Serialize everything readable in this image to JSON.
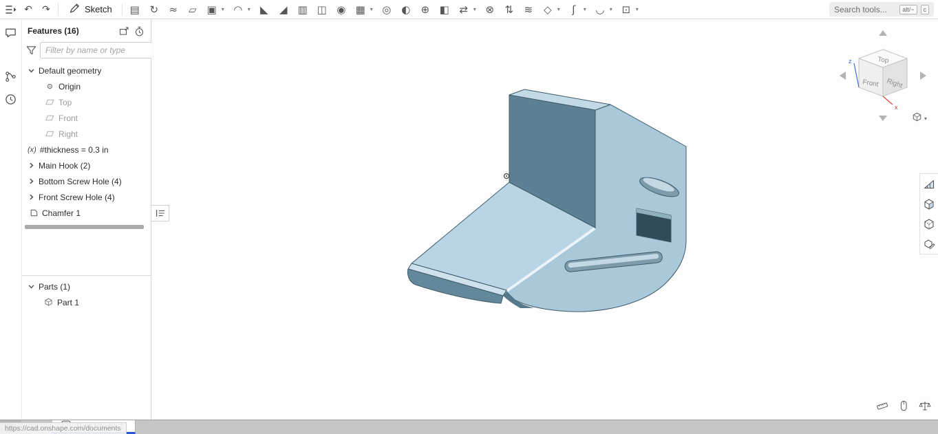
{
  "toolbar": {
    "undo_icon": "↶",
    "redo_icon": "↷",
    "sketch_label": "Sketch",
    "caret_icon": "▾",
    "items": [
      {
        "name": "extrude",
        "icon": "▤",
        "caret": false
      },
      {
        "name": "revolve",
        "icon": "↻",
        "caret": false
      },
      {
        "name": "sweep",
        "icon": "≈",
        "caret": false
      },
      {
        "name": "loft",
        "icon": "▱",
        "caret": false
      },
      {
        "name": "thicken",
        "icon": "▣",
        "caret": true
      },
      {
        "name": "fillet",
        "icon": "◠",
        "caret": true
      },
      {
        "name": "chamfer",
        "icon": "◣",
        "caret": false
      },
      {
        "name": "draft",
        "icon": "◢",
        "caret": false
      },
      {
        "name": "rib",
        "icon": "▥",
        "caret": false
      },
      {
        "name": "shell",
        "icon": "◫",
        "caret": false
      },
      {
        "name": "hole",
        "icon": "◉",
        "caret": false
      },
      {
        "name": "linear-pattern",
        "icon": "▦",
        "caret": true
      },
      {
        "name": "circular-pattern",
        "icon": "◎",
        "caret": false
      },
      {
        "name": "mirror",
        "icon": "◐",
        "caret": false
      },
      {
        "name": "boolean",
        "icon": "⊕",
        "caret": false
      },
      {
        "name": "split",
        "icon": "◧",
        "caret": false
      },
      {
        "name": "transform",
        "icon": "⇄",
        "caret": true
      },
      {
        "name": "delete-face",
        "icon": "⊗",
        "caret": false
      },
      {
        "name": "move-face",
        "icon": "⇅",
        "caret": false
      },
      {
        "name": "offset-surface",
        "icon": "≋",
        "caret": false
      },
      {
        "name": "plane",
        "icon": "◇",
        "caret": true
      },
      {
        "name": "curve",
        "icon": "ʃ",
        "caret": true
      },
      {
        "name": "surface",
        "icon": "◡",
        "caret": true
      },
      {
        "name": "derived",
        "icon": "⊡",
        "caret": true
      }
    ],
    "search_placeholder": "Search tools...",
    "kbd_alt": "alt/~",
    "kbd_c": "c"
  },
  "features_panel": {
    "title": "Features (16)",
    "filter_placeholder": "Filter by name or type",
    "tree": [
      {
        "label": "Default geometry"
      },
      {
        "label": "Origin"
      },
      {
        "label": "Top"
      },
      {
        "label": "Front"
      },
      {
        "label": "Right"
      },
      {
        "label": "#thickness = 0.3 in",
        "icon_text": "(x)"
      },
      {
        "label": "Main Hook (2)"
      },
      {
        "label": "Bottom Screw Hole (4)"
      },
      {
        "label": "Front Screw Hole (4)"
      },
      {
        "label": "Chamfer 1"
      }
    ],
    "parts_title": "Parts (1)",
    "parts": [
      {
        "label": "Part 1"
      }
    ]
  },
  "viewcube": {
    "top": "Top",
    "front": "Front",
    "right": "Right",
    "z": "z",
    "x": "x"
  },
  "bottom": {
    "tab_label": "Part Studio 1"
  },
  "status_url": "https://cad.onshape.com/documents"
}
